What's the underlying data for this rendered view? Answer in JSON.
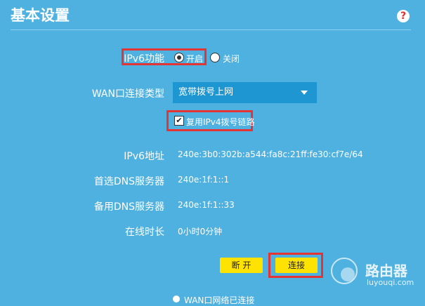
{
  "page": {
    "title": "基本设置",
    "help_icon": "question-icon",
    "help_glyph": "?"
  },
  "ipv6": {
    "label": "IPv6功能",
    "options": [
      "开启",
      "关闭"
    ],
    "selected": "开启"
  },
  "wan": {
    "label": "WAN口连接类型",
    "selected": "宽带拨号上网"
  },
  "reuse": {
    "label": "复用IPv4拨号链路",
    "checked": true,
    "check_glyph": "✔"
  },
  "info": {
    "ipv6_addr": {
      "label": "IPv6地址",
      "value": "240e:3b0:302b:a544:fa8c:21ff:fe30:cf7e/64"
    },
    "dns_primary": {
      "label": "首选DNS服务器",
      "value": "240e:1f:1::1"
    },
    "dns_secondary": {
      "label": "备用DNS服务器",
      "value": "240e:1f:1::33"
    },
    "online_time": {
      "label": "在线时长",
      "value": "0小时0分钟"
    }
  },
  "buttons": {
    "disconnect": "断 开",
    "connect": "连接"
  },
  "status": {
    "text": "WAN口网络已连接"
  },
  "watermark": {
    "cn": "路由器",
    "en": "luyouqi.com"
  },
  "colors": {
    "background": "#4fb1df",
    "select": "#1d96d2",
    "button": "#ffe300",
    "highlight": "#e53434"
  }
}
